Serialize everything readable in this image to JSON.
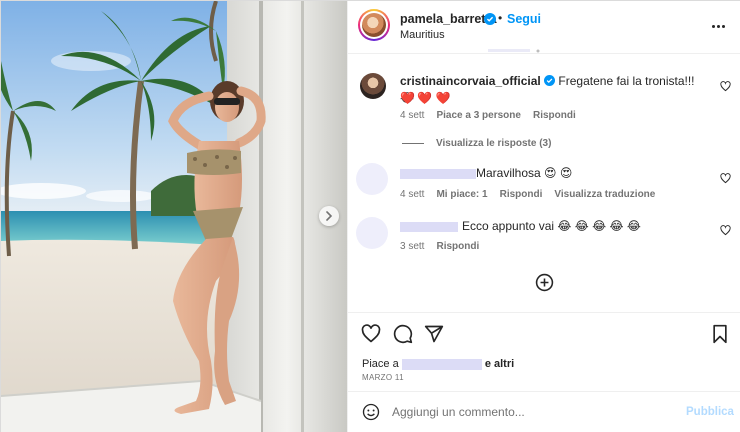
{
  "post": {
    "username": "pamela_barretta",
    "follow_label": "Segui",
    "separator": "•",
    "location": "Mauritius"
  },
  "colors": {
    "accent": "#0095f6",
    "verified": "#0095f6",
    "placeholder_redaction": "#dcdcf6",
    "heart_red": "#ed4956"
  },
  "comments": [
    {
      "username": "cristinaincorvaia_official",
      "text": "Fregatene fai la tronista!!! 😂 ❤️ ❤️",
      "wrap": "❤️",
      "time": "4 sett",
      "likes": "Piace a 3 persone",
      "reply": "Rispondi",
      "view_replies": "Visualizza le risposte (3)"
    },
    {
      "text": "Maravilhosa 😍 😍",
      "time": "4 sett",
      "likes": "Mi piace: 1",
      "reply": "Rispondi",
      "translate": "Visualizza traduzione"
    },
    {
      "text": "Ecco appunto vai 😂 😂 😂 😂 😂",
      "time": "3 sett",
      "reply": "Rispondi"
    }
  ],
  "footer": {
    "likes_prefix": "Piace a",
    "likes_suffix": "e altri",
    "date": "MARZO 11",
    "comment_placeholder": "Aggiungi un commento...",
    "publish_label": "Pubblica"
  },
  "icons": [
    "verified-badge-icon",
    "more-options-icon",
    "heart-icon",
    "comment-icon",
    "share-icon",
    "bookmark-icon",
    "add-circle-icon",
    "emoji-icon",
    "chevron-right-icon"
  ]
}
